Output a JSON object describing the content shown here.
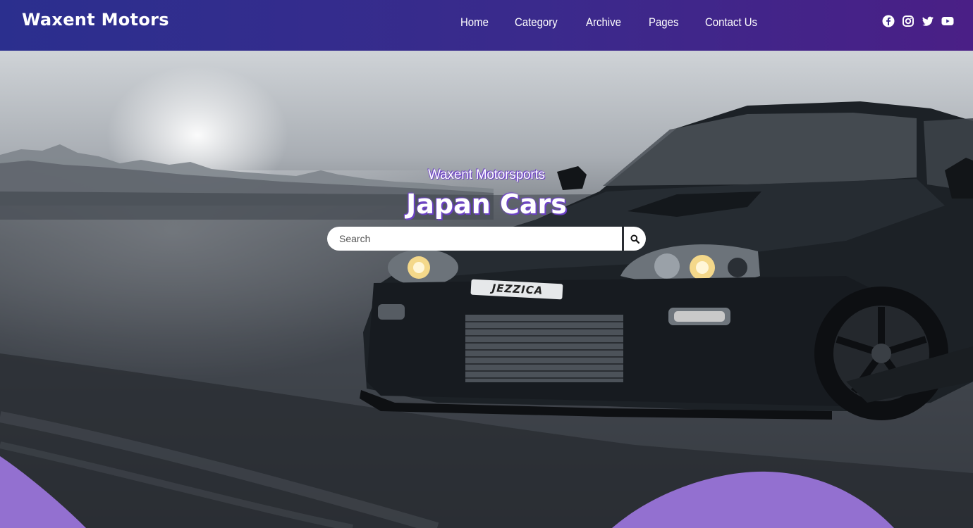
{
  "header": {
    "brand": "Waxent Motors",
    "nav": [
      "Home",
      "Category",
      "Archive",
      "Pages",
      "Contact Us"
    ],
    "social_icons": [
      "facebook-icon",
      "instagram-icon",
      "twitter-icon",
      "youtube-icon"
    ]
  },
  "hero": {
    "subtitle": "Waxent Motorsports",
    "title": "Japan Cars",
    "plate": "JEZZICA",
    "search": {
      "placeholder": "Search",
      "icon": "search-icon"
    }
  },
  "colors": {
    "header_start": "#2b2f8e",
    "header_end": "#4a1f86",
    "accent_wave": "#9370d0",
    "text_outline": "#6a3fc4"
  }
}
